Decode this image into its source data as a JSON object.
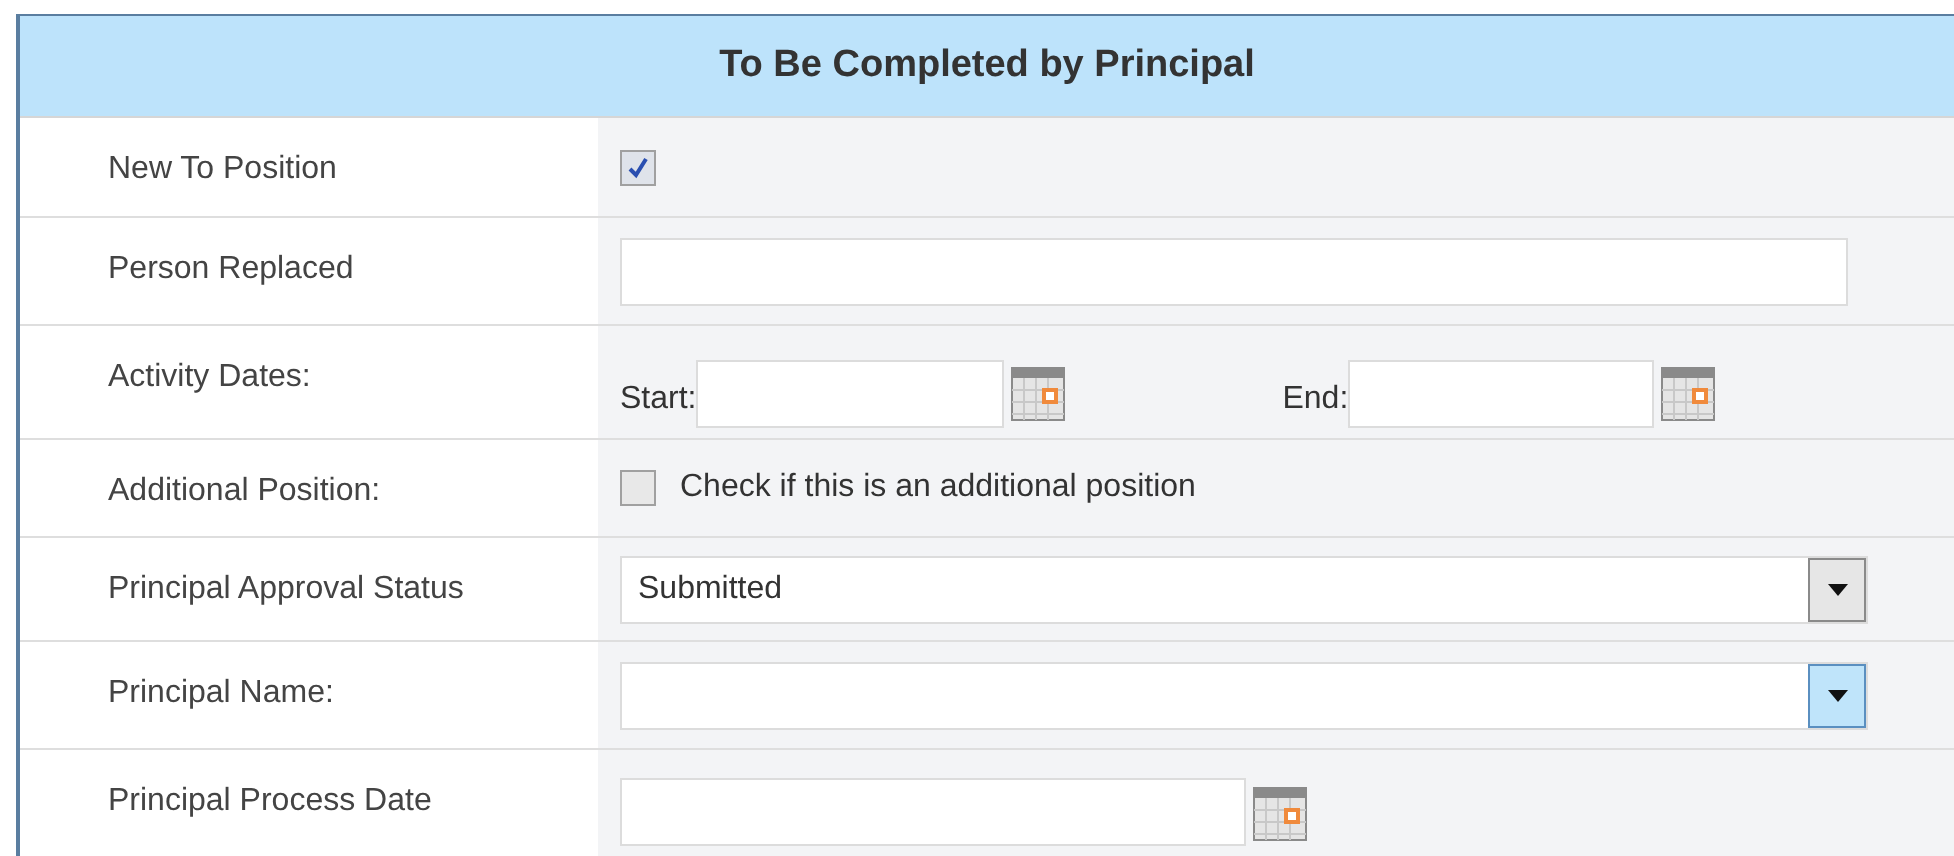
{
  "header": {
    "title": "To Be Completed by Principal"
  },
  "rows": [
    {
      "kind": "checkbox",
      "label": "New To Position",
      "checked": true
    },
    {
      "kind": "text",
      "label": "Person Replaced"
    },
    {
      "kind": "daterange",
      "label": "Activity Dates:",
      "start_label": "Start:",
      "end_label": "End:"
    },
    {
      "kind": "checkbox",
      "label": "Additional Position:",
      "checked": false,
      "text": "Check if this is an additional position"
    },
    {
      "kind": "select",
      "label": "Principal Approval Status",
      "value": "Submitted",
      "highlighted": false
    },
    {
      "kind": "select",
      "label": "Principal Name:",
      "highlighted": true
    },
    {
      "kind": "date",
      "label": "Principal Process Date"
    }
  ]
}
